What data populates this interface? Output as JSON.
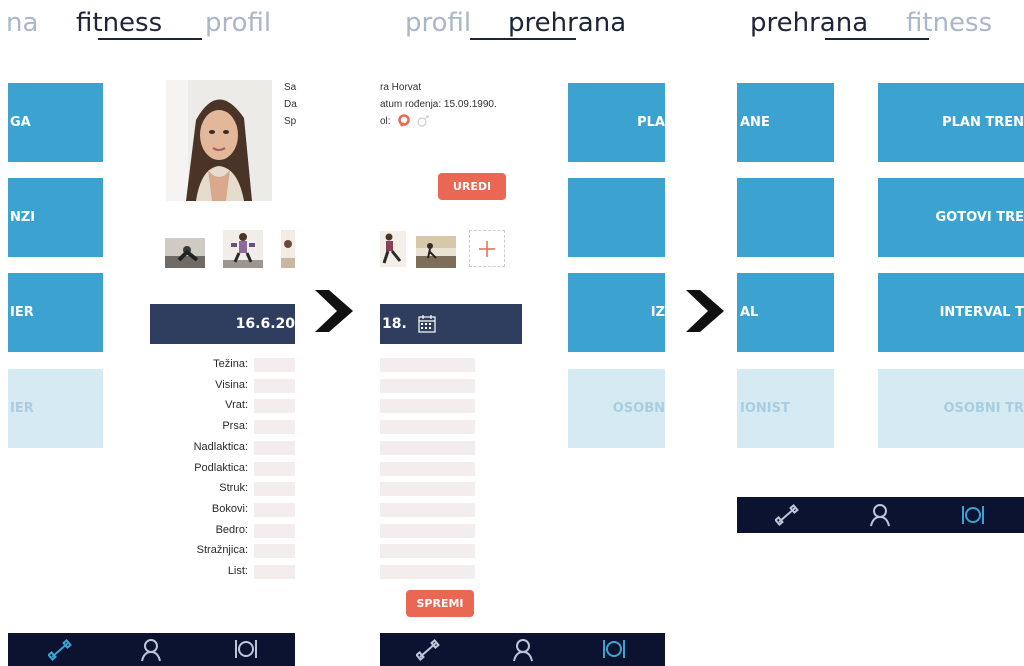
{
  "panel1": {
    "header": {
      "prev": "na",
      "current": "fitness",
      "next": "profil"
    },
    "tiles": [
      "GA",
      "NZI",
      "IER",
      "IER"
    ],
    "tiles_pale": [
      false,
      false,
      false,
      true
    ]
  },
  "profile": {
    "name_cut": "Sa",
    "dob_cut": "Da",
    "sex_cut": "Sp",
    "date_bar": "16.6.20",
    "measurements": [
      "Težina:",
      "Visina:",
      "Vrat:",
      "Prsa:",
      "Nadlaktica:",
      "Podlaktica:",
      "Struk:",
      "Bokovi:",
      "Bedro:",
      "Stražnjica:",
      "List:"
    ]
  },
  "panel2": {
    "header": {
      "prev": "profil",
      "current": "prehrana"
    },
    "name_line": "ra Horvat",
    "dob_line": "atum rođenja: 15.09.1990.",
    "sex_line": "ol:",
    "edit_button": "UREDI",
    "date_bar": "18.",
    "save_button": "SPREMI",
    "tiles": [
      "PLA",
      "",
      "IZ",
      "OSOBN"
    ],
    "tiles_pale": [
      false,
      false,
      false,
      true
    ]
  },
  "panel3": {
    "header": {
      "current": "prehrana",
      "next": "fitness"
    },
    "left_tiles": [
      "ANE",
      "",
      "AL",
      "IONIST"
    ],
    "left_tiles_pale": [
      false,
      false,
      false,
      true
    ],
    "right_tiles": [
      "PLAN TREN",
      "GOTOVI TRE",
      "INTERVAL T",
      "OSOBNI TR"
    ],
    "right_tiles_pale": [
      false,
      false,
      false,
      true
    ]
  },
  "nav": {
    "items": [
      {
        "icon": "dumbbell-icon",
        "label": "fitness"
      },
      {
        "icon": "user-icon",
        "label": "profil"
      },
      {
        "icon": "plate-icon",
        "label": "prehrana"
      }
    ]
  },
  "colors": {
    "accent": "#3ca3d1",
    "accent_pale": "#d6eaf3",
    "navy": "#0b1330",
    "datebar": "#2f3e5f",
    "button": "#ea6753"
  }
}
